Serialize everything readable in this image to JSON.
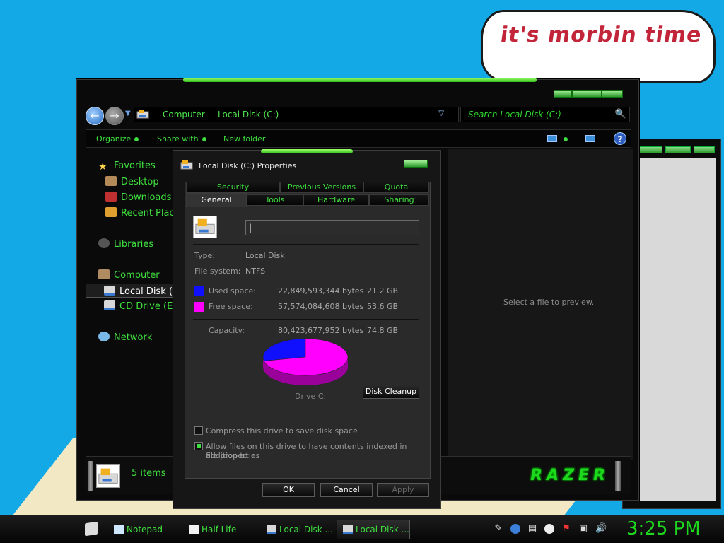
{
  "desktop": {
    "bubble_text": "it's morbin time"
  },
  "explorer": {
    "address": {
      "crumb1": "Computer",
      "crumb2": "Local Disk (C:)"
    },
    "search_placeholder": "Search Local Disk (C:)",
    "command_bar": {
      "organize": "Organize",
      "share_with": "Share with",
      "new_folder": "New folder"
    },
    "nav": {
      "favorites": "Favorites",
      "desktop": "Desktop",
      "downloads": "Downloads",
      "recent_places": "Recent Places",
      "libraries": "Libraries",
      "computer": "Computer",
      "local_disk": "Local Disk (C:)",
      "cd_drive": "CD Drive (E:)",
      "network": "Network"
    },
    "preview_text": "Select a file to preview.",
    "details": {
      "items": "5 items",
      "brand": "RAZER"
    }
  },
  "dialog": {
    "title": "Local Disk (C:) Properties",
    "tabs_row1": [
      "Security",
      "Previous Versions",
      "Quota"
    ],
    "tabs_row2": [
      "General",
      "Tools",
      "Hardware",
      "Sharing"
    ],
    "active_tab": "General",
    "name_value": "",
    "type_label": "Type:",
    "type_value": "Local Disk",
    "fs_label": "File system:",
    "fs_value": "NTFS",
    "used_label": "Used space:",
    "used_bytes": "22,849,593,344 bytes",
    "used_gb": "21.2 GB",
    "free_label": "Free space:",
    "free_bytes": "57,574,084,608 bytes",
    "free_gb": "53.6 GB",
    "cap_label": "Capacity:",
    "cap_bytes": "80,423,677,952 bytes",
    "cap_gb": "74.8 GB",
    "pie_caption": "Drive C:",
    "used_fraction": 0.284,
    "colors": {
      "used": "#1010ff",
      "free": "#ff00ff"
    },
    "cleanup": "Disk Cleanup",
    "compress": "Compress this drive to save disk space",
    "index_line1": "Allow files on this drive to have contents indexed in addition to",
    "index_line2": "file properties",
    "compress_checked": false,
    "index_checked": true,
    "ok": "OK",
    "cancel": "Cancel",
    "apply": "Apply"
  },
  "taskbar": {
    "tasks": [
      "Notepad",
      "Half-Life",
      "Local Disk ...",
      "Local Disk ..."
    ],
    "clock": "3:25 PM"
  }
}
